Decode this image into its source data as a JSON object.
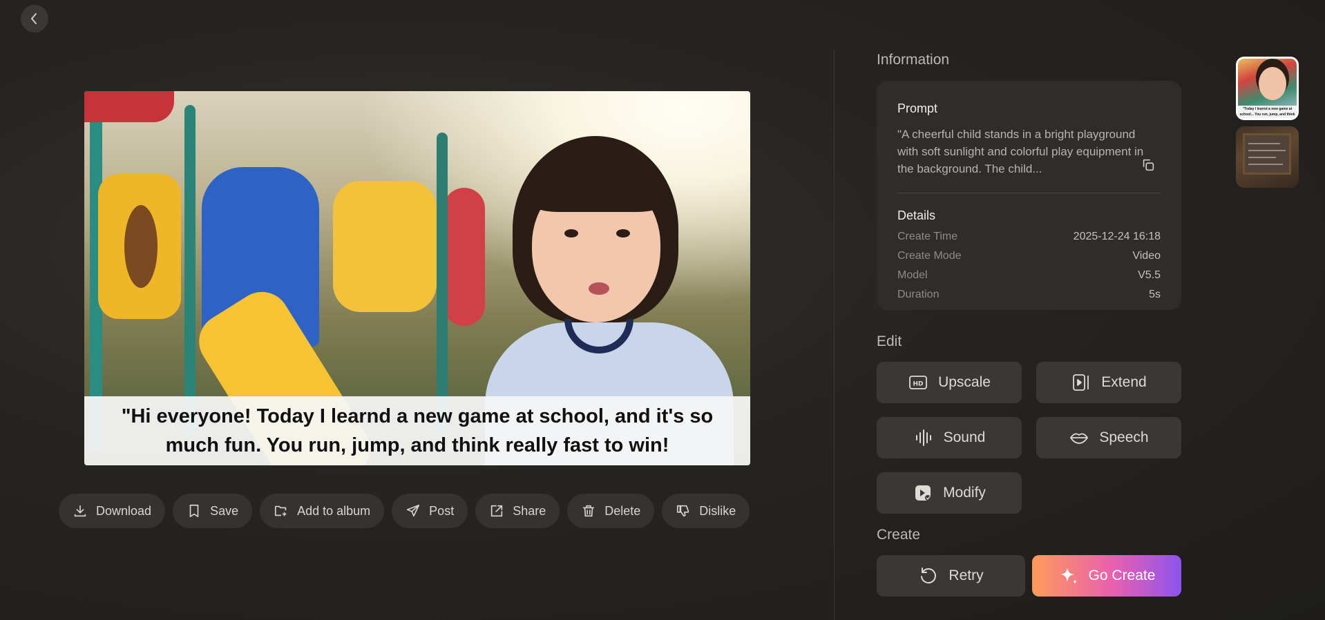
{
  "preview": {
    "caption": "\"Hi everyone! Today I learnd a new game at school, and it's so much fun. You run, jump, and think really fast to win!"
  },
  "actions": [
    {
      "label": "Download"
    },
    {
      "label": "Save"
    },
    {
      "label": "Add to album"
    },
    {
      "label": "Post"
    },
    {
      "label": "Share"
    },
    {
      "label": "Delete"
    },
    {
      "label": "Dislike"
    }
  ],
  "info": {
    "title": "Information",
    "prompt_heading": "Prompt",
    "prompt_text": "\"A cheerful child stands in a bright playground with soft sunlight and colorful play equipment in the background. The child...",
    "details_heading": "Details",
    "details": [
      {
        "label": "Create Time",
        "value": "2025-12-24 16:18"
      },
      {
        "label": "Create Mode",
        "value": "Video"
      },
      {
        "label": "Model",
        "value": "V5.5"
      },
      {
        "label": "Duration",
        "value": "5s"
      }
    ]
  },
  "edit": {
    "title": "Edit",
    "upscale": "Upscale",
    "extend": "Extend",
    "sound": "Sound",
    "speech": "Speech",
    "modify": "Modify"
  },
  "create": {
    "title": "Create",
    "retry": "Retry",
    "go_create": "Go Create"
  },
  "thumbnails": {
    "thumb1_caption": "\"Today I learnd a new game at school... You run, jump, and think really fa..."
  },
  "colors": {
    "background": "#262421",
    "card": "#2f2d2b",
    "button": "#3a3835",
    "gradient_start": "#ff9a5a",
    "gradient_end": "#8d54ee"
  }
}
